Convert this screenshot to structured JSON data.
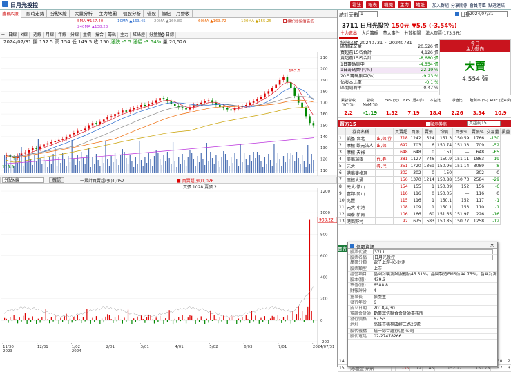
{
  "window": {
    "title": "日月光投控",
    "top_buttons": [
      "看法",
      "報表",
      "機械",
      "主力",
      "地址"
    ],
    "top_links": [
      "加入群組",
      "分享關係",
      "會員專區",
      "點選連結"
    ]
  },
  "tabs": [
    "籌碼K線",
    "即時走勢",
    "分點K線",
    "大量分析",
    "主力地圖",
    "個股分析",
    "借股",
    "籌紀",
    "月營收"
  ],
  "ma_legend": [
    {
      "label": "5MA ▼157.40",
      "color": "#d23"
    },
    {
      "label": "10MA ▲163.45",
      "color": "#26c"
    },
    {
      "label": "20MA ▲169.80",
      "color": "#888"
    },
    {
      "label": "60MA ▲163.72",
      "color": "#e60"
    },
    {
      "label": "120MA ▲155.25",
      "color": "#c9a000"
    },
    {
      "label": "240MA ▲138.23",
      "color": "#b3d"
    }
  ],
  "ma_note": "標記收盤價高低",
  "toolbar": [
    "日線",
    "K線",
    "週線",
    "月線",
    "年線",
    "分線",
    "量價",
    "撮合",
    "籌碼",
    "主力",
    "紅綠燈",
    "分量量",
    "日線"
  ],
  "ohlc": {
    "date": "2024/07/31",
    "open": "開 152.5",
    "high": "高 154",
    "low": "低 149.5",
    "close": "收 150",
    "chg": "漲跌 -5.5",
    "pct": "漲幅 -3.54%",
    "vol": "量 20,526"
  },
  "sub_select": "分點K線",
  "sub_button": "確認",
  "sub_legend": {
    "a": "一累計買賣超(張)1,052",
    "b": "■ 買賣超(張)1,026",
    "c": "買張 1028  賣張 2"
  },
  "chart_data": [
    {
      "type": "candlestick",
      "ylim": [
        110,
        215
      ],
      "yticks": [
        110,
        120,
        130,
        140,
        150,
        160,
        170,
        180,
        190,
        200,
        210
      ],
      "annotations": [
        "193.5",
        "116.5"
      ],
      "close": [
        124,
        122,
        121,
        123,
        125,
        126,
        128,
        130,
        129,
        131,
        133,
        134,
        135,
        136,
        137,
        138,
        140,
        142,
        143,
        145,
        146,
        147,
        150,
        152,
        151,
        153,
        155,
        157,
        158,
        160,
        161,
        163,
        162,
        164,
        165,
        166,
        168,
        167,
        169,
        170,
        172,
        174,
        173,
        171,
        169,
        167,
        166,
        165,
        164,
        166,
        168,
        169,
        170,
        171,
        172,
        170,
        168,
        166,
        165,
        164,
        163,
        165,
        166,
        167,
        168,
        170,
        171,
        173,
        175,
        178,
        180,
        183,
        186,
        190,
        193,
        188,
        183,
        176,
        170,
        165,
        158,
        152,
        150
      ]
    },
    {
      "type": "bar",
      "ylim": [
        -200,
        1200
      ],
      "yticks": [
        1200,
        1000,
        800,
        600,
        400,
        200,
        0,
        -200
      ],
      "annotations": [
        "933.22"
      ],
      "xlabels": [
        "11/30\n2023",
        "12/31",
        "1/02\n2024",
        "2/01",
        "3/01",
        "4/01",
        "5/02",
        "6/03",
        "7/01",
        "2024/07/31"
      ]
    }
  ],
  "right": {
    "stat_label": "統計天數",
    "stat_value": "1",
    "date_label": "日期",
    "date_value": "2024/07/31",
    "stock": "3711 日月光投控",
    "price": "150元",
    "change": "▼5.5 (-3.54%)",
    "tabs": [
      "主力進出",
      "大戶籌碼",
      "董大事件",
      "分散相關",
      "法人買賣(173.5元)"
    ],
    "range": "統計區間  20240731 ~ 20240731",
    "summary": [
      {
        "k": "區間成交量",
        "v": "20,526 張"
      },
      {
        "k": "買超前15名合計",
        "v": "4,126 張"
      },
      {
        "k": "賣超前15名合計",
        "v": "-8,680 張"
      },
      {
        "k": "1日籌碼集中",
        "v": "-4,554 張"
      },
      {
        "k": "1日籌碼集中(%)",
        "v": "-22.19 %"
      },
      {
        "k": "20日籌碼集中(%)",
        "v": "-9.23 %"
      },
      {
        "k": "佔股本比重",
        "v": "-0.1 %"
      },
      {
        "k": "區間周轉率",
        "v": "0.47 %"
      }
    ],
    "today": "今日",
    "main_trend": "主力動向",
    "verdict": "大賣",
    "verdict_amount": "4,554 張",
    "metrics_head": [
      "累計營收 YoY(%)",
      "營收 MoM(%)",
      "EPS (元)",
      "EPS (近4季)",
      "本益比",
      "淨值比",
      "殖利率 (%)",
      "ROE (近4季)"
    ],
    "metrics_val": [
      "2.2",
      "-1.19",
      "1.32",
      "7.19",
      "18.4",
      "2.26",
      "3.34",
      "10.9"
    ],
    "buy_title": "買方15",
    "buy_filter": "顯示券商",
    "buy_select": "買超前15",
    "table_head": [
      "",
      "券商名稱",
      "",
      "買賣超",
      "買張",
      "賣張",
      "均價",
      "買張%",
      "賣張%",
      "交易量",
      "損益"
    ],
    "rows": [
      [
        "1",
        "凱基-台北",
        "出,保,券",
        "718",
        "1242",
        "524",
        "151.3",
        "150.59",
        "1766",
        "-130"
      ],
      [
        "2",
        "摩根-歐元法人",
        "出,保",
        "697",
        "703",
        "6",
        "150.74",
        "151.33",
        "709",
        "-52"
      ],
      [
        "3",
        "摩根-天祿",
        "",
        "648",
        "648",
        "0",
        "151",
        "—",
        "648",
        "-65"
      ],
      [
        "4",
        "美商瑞銀",
        "代,券",
        "381",
        "1127",
        "746",
        "150.9",
        "151.11",
        "1863",
        "-19"
      ],
      [
        "5",
        "元大",
        "券,代",
        "351",
        "1720",
        "1369",
        "150.96",
        "151.14",
        "3089",
        "-8"
      ],
      [
        "6",
        "港商麥格理",
        "",
        "302",
        "302",
        "0",
        "150",
        "—",
        "302",
        "0"
      ],
      [
        "7",
        "摩根大通",
        "",
        "156",
        "1370",
        "1214",
        "150.88",
        "150.73",
        "2584",
        "-29"
      ],
      [
        "8",
        "元大-懷山",
        "",
        "154",
        "155",
        "1",
        "150.39",
        "152",
        "156",
        "-6"
      ],
      [
        "9",
        "富邦-岡山",
        "",
        "116",
        "116",
        "0",
        "150.05",
        "—",
        "116",
        "0"
      ],
      [
        "10",
        "兆豐",
        "",
        "115",
        "116",
        "1",
        "150.1",
        "152",
        "117",
        "-1"
      ],
      [
        "11",
        "元大-小港",
        "",
        "108",
        "109",
        "1",
        "150.1",
        "153",
        "110",
        "-1"
      ],
      [
        "12",
        "國泰-新南",
        "",
        "106",
        "166",
        "60",
        "151.65",
        "151.97",
        "226",
        "-16"
      ],
      [
        "13",
        "港商野村",
        "",
        "92",
        "675",
        "583",
        "150.85",
        "150.77",
        "1258",
        "-12"
      ]
    ],
    "sell_title": "賣方15",
    "bottom_rows": [
      [
        "14",
        "元大-喬義",
        "",
        "-40",
        "5",
        "45",
        "151.6",
        "150.58",
        "50",
        "2"
      ],
      [
        "15",
        "永豐金-鼎鼎",
        "",
        "-33",
        "12",
        "45",
        "152.17",
        "150.78",
        "57",
        "3"
      ]
    ]
  },
  "popup": {
    "title": "個股資訊",
    "rows": [
      {
        "k": "股票代號",
        "v": "3711"
      },
      {
        "k": "股票名稱",
        "v": "日月光投控"
      },
      {
        "k": "產業分類",
        "v": "電子上游-IC-封測"
      },
      {
        "k": "股票類型",
        "v": "上市"
      },
      {
        "k": "經營項目",
        "v": "晶圓封裝測試服務佔45.51%，晶圓製造EMS佔44.75%，晶圓封測銷售"
      },
      {
        "k": "股本(億)",
        "v": "439.3"
      },
      {
        "k": "市值(億)",
        "v": "6588.8"
      },
      {
        "k": "財報評分",
        "v": "4"
      },
      {
        "k": "董事長",
        "v": "張虔生"
      },
      {
        "k": "發行年份",
        "v": "6"
      },
      {
        "k": "成立日期",
        "v": "2018/4/30"
      },
      {
        "k": "簽證會計師",
        "v": "勤業眾信聯合會計師事務所"
      },
      {
        "k": "發行價格",
        "v": "67.53"
      },
      {
        "k": "地址",
        "v": "高雄市楠梓區經三路26號"
      },
      {
        "k": "股代機構",
        "v": "統一綜合證券(股)公司"
      },
      {
        "k": "股代電話",
        "v": "02-27478266"
      }
    ]
  }
}
